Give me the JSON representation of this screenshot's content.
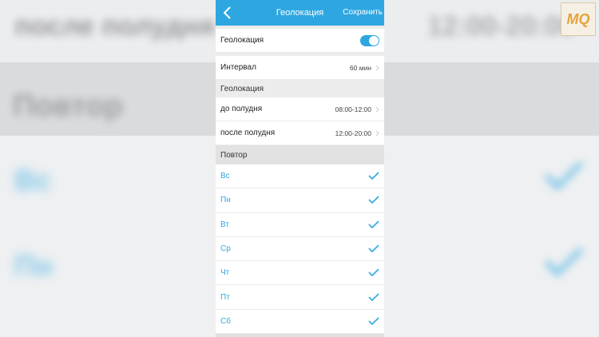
{
  "background": {
    "blur_left_top": "после полудня",
    "blur_right_top": "12:00-20:00",
    "blur_section": "Повтор",
    "blur_day_1": "Вс",
    "blur_day_2": "Пн"
  },
  "logo": {
    "text": "MQ"
  },
  "navbar": {
    "title": "Геолокация",
    "save_label": "Сохранить",
    "back_icon": "chevron-left-icon"
  },
  "geolocation_toggle": {
    "label": "Геолокация",
    "enabled": true
  },
  "interval": {
    "label": "Интервал",
    "value": "60 мин"
  },
  "geolocation_section": {
    "header": "Геолокация",
    "items": [
      {
        "label": "до полудня",
        "value": "08:00-12:00"
      },
      {
        "label": "после полудня",
        "value": "12:00-20:00"
      }
    ]
  },
  "repeat_section": {
    "header": "Повтор",
    "days": [
      {
        "label": "Вс",
        "checked": true
      },
      {
        "label": "Пн",
        "checked": true
      },
      {
        "label": "Вт",
        "checked": true
      },
      {
        "label": "Ср",
        "checked": true
      },
      {
        "label": "Чт",
        "checked": true
      },
      {
        "label": "Пт",
        "checked": true
      },
      {
        "label": "Сб",
        "checked": true
      }
    ]
  },
  "colors": {
    "accent": "#2ea7e0",
    "section_bg": "#ececec"
  }
}
